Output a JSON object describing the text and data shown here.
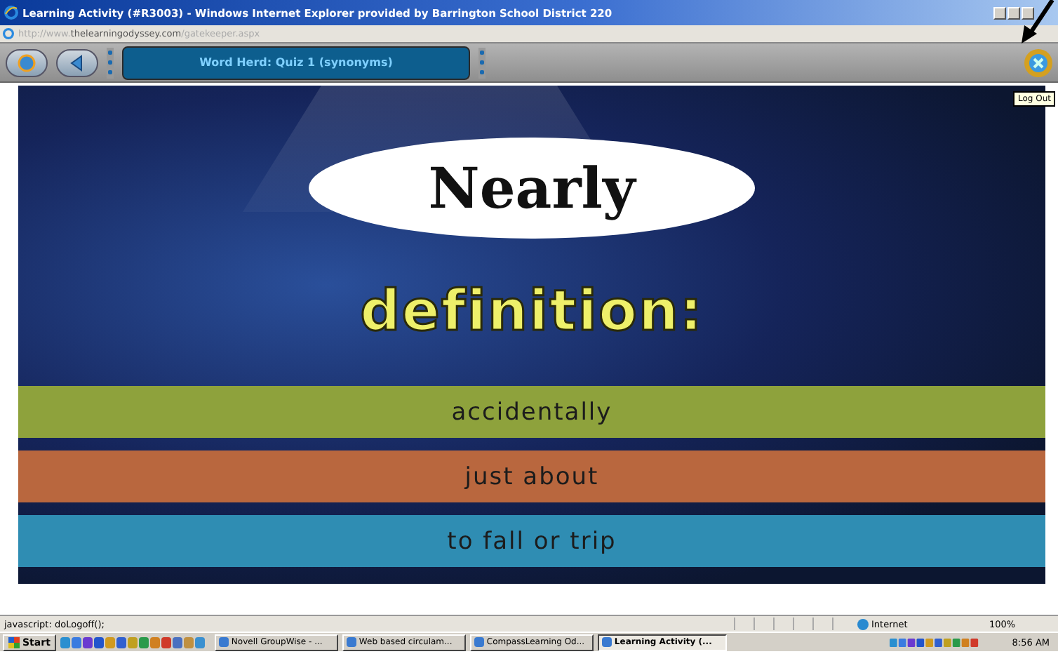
{
  "window": {
    "title": "Learning Activity (#R3003) - Windows Internet Explorer provided by Barrington School District 220"
  },
  "address_bar": {
    "prefix": "http://www.",
    "domain": "thelearningodyssey.com",
    "path": "/gatekeeper.aspx"
  },
  "activity_toolbar": {
    "title": "Word Herd: Quiz 1 (synonyms)",
    "tooltip": "Log Out"
  },
  "quiz": {
    "word": "Nearly",
    "prompt": "definition:",
    "answers": [
      {
        "text": "accidentally",
        "color": "#8ea23c"
      },
      {
        "text": "just about",
        "color": "#b9673e"
      },
      {
        "text": "to fall or trip",
        "color": "#2f8db3"
      }
    ]
  },
  "status_bar": {
    "text": "javascript: doLogoff();",
    "zone": "Internet",
    "zoom": "100%"
  },
  "taskbar": {
    "start": "Start",
    "tasks": [
      {
        "label": "Novell GroupWise - ...",
        "selected": false
      },
      {
        "label": "Web based circulam...",
        "selected": false
      },
      {
        "label": "CompassLearning Od...",
        "selected": false
      },
      {
        "label": "Learning Activity (...",
        "selected": true
      }
    ],
    "clock": "8:56 AM"
  }
}
